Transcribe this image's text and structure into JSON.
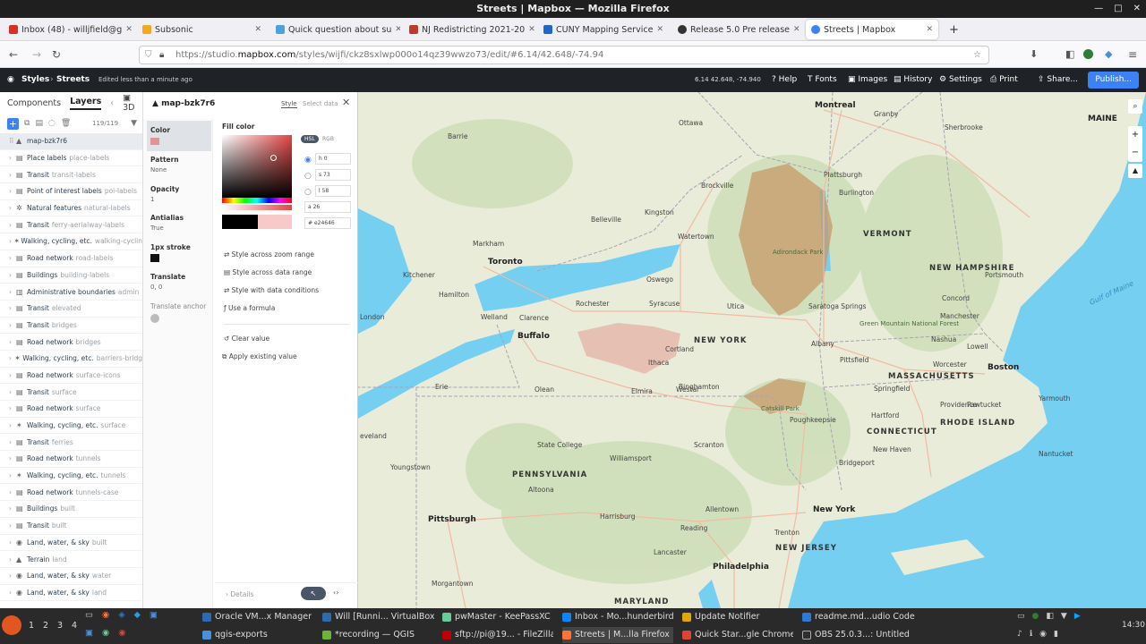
{
  "window": {
    "title": "Streets | Mapbox — Mozilla Firefox"
  },
  "tabs": [
    {
      "label": "Inbox (48) - willjfield@g",
      "color": "#d93025"
    },
    {
      "label": "Subsonic",
      "color": "#f5a623"
    },
    {
      "label": "Quick question about su",
      "color": "#4aa3df"
    },
    {
      "label": "NJ Redistricting 2021-20",
      "color": "#c0392b"
    },
    {
      "label": "CUNY Mapping Service",
      "color": "#1e66c8"
    },
    {
      "label": "Release 5.0 Pre release",
      "color": "#333333"
    },
    {
      "label": "Streets | Mapbox",
      "color": "#3b82f6"
    }
  ],
  "url": {
    "prefix": "https://studio.",
    "domain": "mapbox.com",
    "rest": "/styles/wijfi/ckz8sxlwp000o14qz39wwzo73/edit/#6.14/42.648/-74.94"
  },
  "app": {
    "styles": "Styles",
    "style_name": "Streets",
    "edited": "Edited less than a minute ago",
    "coords": "6.14  42.648, -74.940",
    "help": "Help",
    "fonts": "Fonts",
    "images": "Images",
    "history": "History",
    "settings": "Settings",
    "print": "Print",
    "share": "Share...",
    "publish": "Publish..."
  },
  "left": {
    "tabs": {
      "components": "Components",
      "layers": "Layers",
      "three_d": "3D"
    },
    "count": "119/119",
    "layers": [
      {
        "group": "map-bzk7r6",
        "name": "",
        "icon": "▲",
        "sel": true
      },
      {
        "group": "Place labels",
        "name": "place-labels",
        "icon": "▤"
      },
      {
        "group": "Transit",
        "name": "transit-labels",
        "icon": "▤"
      },
      {
        "group": "Point of interest labels",
        "name": "poi-labels",
        "icon": "▤"
      },
      {
        "group": "Natural features",
        "name": "natural-labels",
        "icon": "✲"
      },
      {
        "group": "Transit",
        "name": "ferry-aerialway-labels",
        "icon": "▤"
      },
      {
        "group": "Walking, cycling, etc.",
        "name": "walking-cyclin",
        "icon": "✶"
      },
      {
        "group": "Road network",
        "name": "road-labels",
        "icon": "▤"
      },
      {
        "group": "Buildings",
        "name": "building-labels",
        "icon": "▤"
      },
      {
        "group": "Administrative boundaries",
        "name": "admin",
        "icon": "▥"
      },
      {
        "group": "Transit",
        "name": "elevated",
        "icon": "▤"
      },
      {
        "group": "Transit",
        "name": "bridges",
        "icon": "▤"
      },
      {
        "group": "Road network",
        "name": "bridges",
        "icon": "▤"
      },
      {
        "group": "Walking, cycling, etc.",
        "name": "barriers-bridg",
        "icon": "✶"
      },
      {
        "group": "Road network",
        "name": "surface-icons",
        "icon": "▤"
      },
      {
        "group": "Transit",
        "name": "surface",
        "icon": "▤"
      },
      {
        "group": "Road network",
        "name": "surface",
        "icon": "▤"
      },
      {
        "group": "Walking, cycling, etc.",
        "name": "surface",
        "icon": "✶"
      },
      {
        "group": "Transit",
        "name": "ferries",
        "icon": "▤"
      },
      {
        "group": "Road network",
        "name": "tunnels",
        "icon": "▤"
      },
      {
        "group": "Walking, cycling, etc.",
        "name": "tunnels",
        "icon": "✶"
      },
      {
        "group": "Road network",
        "name": "tunnels-case",
        "icon": "▤"
      },
      {
        "group": "Buildings",
        "name": "built",
        "icon": "▤"
      },
      {
        "group": "Transit",
        "name": "built",
        "icon": "▤"
      },
      {
        "group": "Land, water, & sky",
        "name": "built",
        "icon": "◉"
      },
      {
        "group": "Terrain",
        "name": "land",
        "icon": "▲"
      },
      {
        "group": "Land, water, & sky",
        "name": "water",
        "icon": "◉"
      },
      {
        "group": "Land, water, & sky",
        "name": "land",
        "icon": "◉"
      }
    ]
  },
  "mid": {
    "layer_name": "map-bzk7r6",
    "tab_style": "Style",
    "tab_select": "Select data",
    "props": {
      "color": "Color",
      "pattern": "Pattern",
      "pattern_val": "None",
      "opacity": "Opacity",
      "opacity_val": "1",
      "antialias": "Antialias",
      "antialias_val": "True",
      "stroke": "1px stroke",
      "translate": "Translate",
      "translate_val": "0, 0",
      "anchor": "Translate anchor"
    },
    "fill_label": "Fill color",
    "hsl": "HSL",
    "rgb": "RGB",
    "h_val": "0",
    "s_val": "73",
    "l_val": "58",
    "a_val": "26",
    "hex_val": "e24646",
    "fill_color": "#e24646",
    "opts": [
      "Style across zoom range",
      "Style across data range",
      "Style with data conditions",
      "Use a formula"
    ],
    "clear": "Clear value",
    "apply": "Apply existing value",
    "details": "Details"
  },
  "map": {
    "labels": [
      {
        "t": "Ottawa"
      },
      {
        "t": "Montreal"
      },
      {
        "t": "MAINE"
      },
      {
        "t": "Toronto"
      },
      {
        "t": "Kingston"
      },
      {
        "t": "Buffalo"
      },
      {
        "t": "Rochester"
      },
      {
        "t": "NEW YORK"
      },
      {
        "t": "Albany"
      },
      {
        "t": "Syracuse"
      },
      {
        "t": "Ithaca"
      },
      {
        "t": "Utica"
      },
      {
        "t": "VERMONT"
      },
      {
        "t": "NEW HAMPSHIRE"
      },
      {
        "t": "Burlington"
      },
      {
        "t": "Plattsburgh"
      },
      {
        "t": "Adirondack Park"
      },
      {
        "t": "Catskill Park"
      },
      {
        "t": "MASSACHUSETTS"
      },
      {
        "t": "Boston"
      },
      {
        "t": "Springfield"
      },
      {
        "t": "Hartford"
      },
      {
        "t": "CONNECTICUT"
      },
      {
        "t": "RHODE ISLAND"
      },
      {
        "t": "Providence"
      },
      {
        "t": "New York"
      },
      {
        "t": "PENNSYLVANIA"
      },
      {
        "t": "Pittsburgh"
      },
      {
        "t": "Philadelphia"
      },
      {
        "t": "Allentown"
      },
      {
        "t": "Scranton"
      },
      {
        "t": "Erie"
      },
      {
        "t": "Hamilton"
      },
      {
        "t": "London"
      },
      {
        "t": "Barrie"
      },
      {
        "t": "Binghamton"
      },
      {
        "t": "Elmira"
      },
      {
        "t": "Watertown"
      },
      {
        "t": "Brockville"
      },
      {
        "t": "Belleville"
      },
      {
        "t": "Oswego"
      },
      {
        "t": "Saratoga Springs"
      },
      {
        "t": "Pittsfield"
      },
      {
        "t": "Worcester"
      },
      {
        "t": "Concord"
      },
      {
        "t": "Manchester"
      },
      {
        "t": "Portsmouth"
      },
      {
        "t": "Nashua"
      },
      {
        "t": "Lowell"
      },
      {
        "t": "Poughkeepsie"
      },
      {
        "t": "Bridgeport"
      },
      {
        "t": "New Haven"
      },
      {
        "t": "Williamsport"
      },
      {
        "t": "State College"
      },
      {
        "t": "Harrisburg"
      },
      {
        "t": "Reading"
      },
      {
        "t": "Lancaster"
      },
      {
        "t": "Trenton"
      },
      {
        "t": "NEW JERSEY"
      },
      {
        "t": "Morgantown"
      },
      {
        "t": "Youngstown"
      },
      {
        "t": "Altoona"
      },
      {
        "t": "eveland"
      },
      {
        "t": "Kitchener"
      },
      {
        "t": "Markham"
      },
      {
        "t": "Welland"
      },
      {
        "t": "Clarence"
      },
      {
        "t": "Olean"
      },
      {
        "t": "Westal"
      },
      {
        "t": "Cortland"
      },
      {
        "t": "Gulf of Maine"
      },
      {
        "t": "Green Mountain National Forest"
      },
      {
        "t": "Granby"
      },
      {
        "t": "Sherbrooke"
      },
      {
        "t": "Nantucket"
      },
      {
        "t": "Yarmouth"
      },
      {
        "t": "Pawtucket"
      },
      {
        "t": "MARYLAND"
      }
    ]
  },
  "taskbar": {
    "row1": [
      "Oracle VM...x Manager",
      "Will [Runni... VirtualBox",
      "pwMaster - KeePassXC",
      "Inbox - Mo...hunderbird",
      "Update Notifier",
      "readme.md...udio Code"
    ],
    "row2": [
      "qgis-exports",
      "*recording — QGIS",
      "sftp://pi@19... - FileZilla",
      "Streets | M...lla Firefox",
      "Quick Star...gle Chrome",
      "OBS 25.0.3...: Untitled"
    ],
    "workspaces": [
      "1",
      "2",
      "3",
      "4"
    ],
    "clock": "14:30"
  }
}
